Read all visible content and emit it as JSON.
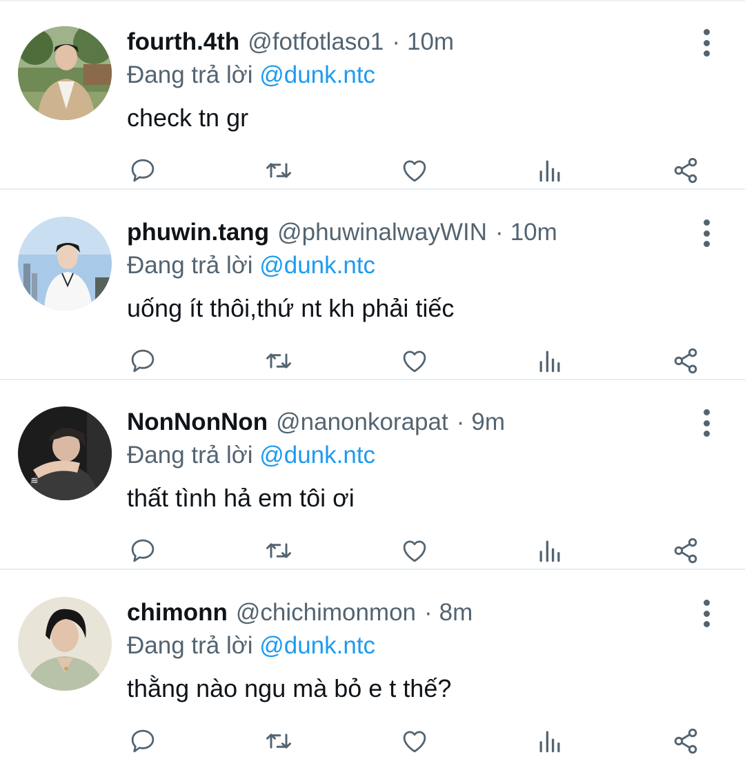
{
  "reply_prefix": "Đang trả lời",
  "colors": {
    "text": "#0f1419",
    "secondary": "#536471",
    "accent": "#1d9bf0",
    "divider": "#e6ecf0"
  },
  "icons": {
    "reply": "reply-icon",
    "retweet": "retweet-icon",
    "like": "like-icon",
    "analytics": "analytics-icon",
    "share": "share-icon",
    "more": "more-icon"
  },
  "tweets": [
    {
      "display_name": "fourth.4th",
      "handle": "@fotfotlaso1",
      "separator": "·",
      "time": "10m",
      "replying_to": "@dunk.ntc",
      "text": "check tn gr"
    },
    {
      "display_name": "phuwin.tang",
      "handle": "@phuwinalwayWIN",
      "separator": "·",
      "time": "10m",
      "replying_to": "@dunk.ntc",
      "text": "uống ít thôi,thứ nt kh phải tiếc"
    },
    {
      "display_name": "NonNonNon",
      "handle": "@nanonkorapat",
      "separator": "·",
      "time": "9m",
      "replying_to": "@dunk.ntc",
      "text": "thất tình hả em tôi ơi"
    },
    {
      "display_name": "chimonn",
      "handle": "@chichimonmon",
      "separator": "·",
      "time": "8m",
      "replying_to": "@dunk.ntc",
      "text": "thằng nào ngu mà bỏ e t thế?"
    }
  ]
}
